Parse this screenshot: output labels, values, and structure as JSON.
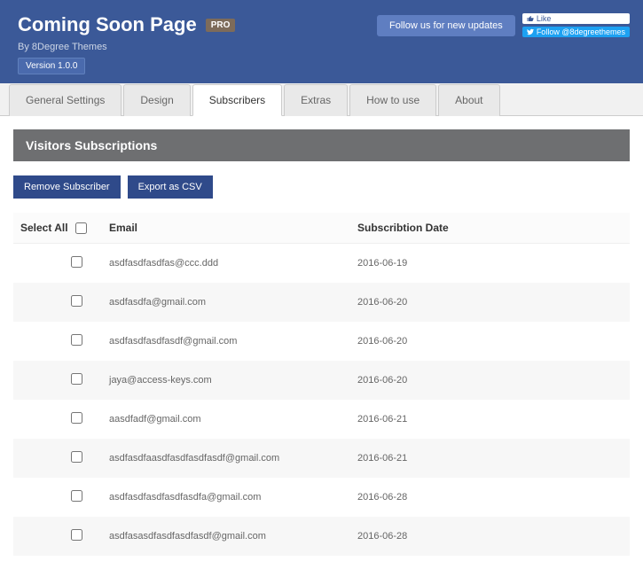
{
  "header": {
    "title": "Coming Soon Page",
    "badge": "PRO",
    "subtitle": "By 8Degree Themes",
    "version": "Version 1.0.0",
    "follow_label": "Follow us for new updates",
    "like_label": "Like",
    "twitter_label": "Follow @8degreethemes"
  },
  "tabs": [
    {
      "label": "General Settings",
      "active": false
    },
    {
      "label": "Design",
      "active": false
    },
    {
      "label": "Subscribers",
      "active": true
    },
    {
      "label": "Extras",
      "active": false
    },
    {
      "label": "How to use",
      "active": false
    },
    {
      "label": "About",
      "active": false
    }
  ],
  "section_title": "Visitors Subscriptions",
  "actions": {
    "remove_label": "Remove Subscriber",
    "export_label": "Export as CSV"
  },
  "table": {
    "select_all_label": "Select All",
    "col_email": "Email",
    "col_date": "Subscribtion Date",
    "rows": [
      {
        "email": "asdfasdfasdfas@ccc.ddd",
        "date": "2016-06-19"
      },
      {
        "email": "asdfasdfa@gmail.com",
        "date": "2016-06-20"
      },
      {
        "email": "asdfasdfasdfasdf@gmail.com",
        "date": "2016-06-20"
      },
      {
        "email": "jaya@access-keys.com",
        "date": "2016-06-20"
      },
      {
        "email": "aasdfadf@gmail.com",
        "date": "2016-06-21"
      },
      {
        "email": "asdfasdfaasdfasdfasdfasdf@gmail.com",
        "date": "2016-06-21"
      },
      {
        "email": "asdfasdfasdfasdfasdfa@gmail.com",
        "date": "2016-06-28"
      },
      {
        "email": "asdfasasdfasdfasdfasdf@gmail.com",
        "date": "2016-06-28"
      }
    ]
  }
}
